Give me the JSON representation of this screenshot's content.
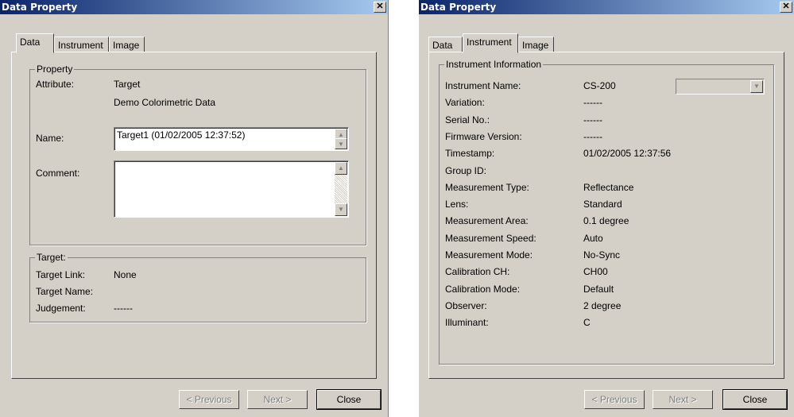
{
  "left_dialog": {
    "title": "Data Property",
    "tabs": [
      "Data",
      "Instrument",
      "Image"
    ],
    "property_group": {
      "legend": "Property",
      "attribute_label": "Attribute:",
      "attribute_value": "Target",
      "attribute_sub": "Demo Colorimetric Data",
      "name_label": "Name:",
      "name_value": "Target1 (01/02/2005 12:37:52)",
      "comment_label": "Comment:",
      "comment_value": ""
    },
    "target_group": {
      "legend": "Target:",
      "rows": [
        {
          "label": "Target Link:",
          "value": "None"
        },
        {
          "label": "Target Name:",
          "value": ""
        },
        {
          "label": "Judgement:",
          "value": "------"
        }
      ]
    },
    "buttons": {
      "previous": "< Previous",
      "next": "Next >",
      "close": "Close"
    }
  },
  "right_dialog": {
    "title": "Data Property",
    "tabs": [
      "Data",
      "Instrument",
      "Image"
    ],
    "group_legend": "Instrument Information",
    "rows": [
      {
        "label": "Instrument Name:",
        "value": "CS-200"
      },
      {
        "label": "Variation:",
        "value": "------"
      },
      {
        "label": "Serial No.:",
        "value": "------"
      },
      {
        "label": "Firmware Version:",
        "value": "------"
      },
      {
        "label": "Timestamp:",
        "value": "01/02/2005 12:37:56"
      },
      {
        "label": "Group ID:",
        "value": ""
      },
      {
        "label": "Measurement Type:",
        "value": "Reflectance"
      },
      {
        "label": "Lens:",
        "value": "Standard"
      },
      {
        "label": "Measurement Area:",
        "value": "0.1 degree"
      },
      {
        "label": "Measurement Speed:",
        "value": "Auto"
      },
      {
        "label": "Measurement Mode:",
        "value": "No-Sync"
      },
      {
        "label": "Calibration CH:",
        "value": "CH00"
      },
      {
        "label": "Calibration Mode:",
        "value": "Default"
      },
      {
        "label": "Observer:",
        "value": "2 degree"
      },
      {
        "label": "Illuminant:",
        "value": "C"
      }
    ],
    "buttons": {
      "previous": "< Previous",
      "next": "Next >",
      "close": "Close"
    }
  }
}
